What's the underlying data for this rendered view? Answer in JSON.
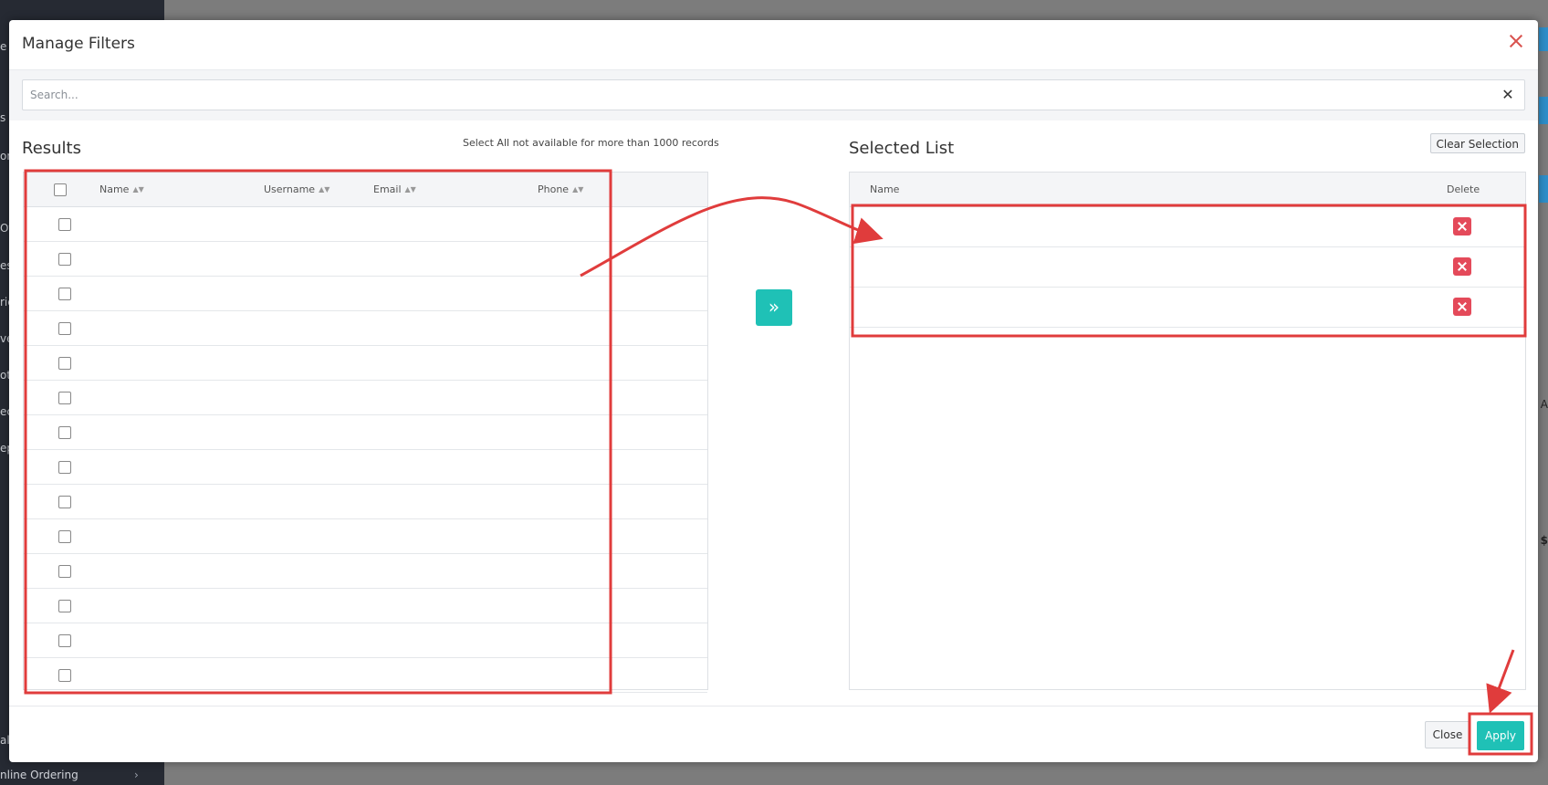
{
  "background": {
    "sidebar_bottom_item": "nline Ordering",
    "sidebar_fragments": [
      "e",
      "s",
      "on",
      "Of",
      "es",
      "ric",
      "ve",
      "ot",
      "ec",
      "ep",
      "al"
    ],
    "right_fragments": [
      "A",
      "$"
    ]
  },
  "modal": {
    "title": "Manage Filters",
    "search": {
      "placeholder": "Search...",
      "value": ""
    },
    "results": {
      "title": "Results",
      "note": "Select All not available for more than 1000 records",
      "columns": [
        "Name",
        "Username",
        "Email",
        "Phone"
      ],
      "row_count": 14
    },
    "move_button_glyph": "»",
    "selected": {
      "title": "Selected List",
      "clear_label": "Clear Selection",
      "columns": {
        "name": "Name",
        "delete": "Delete"
      },
      "rows": 3
    },
    "footer": {
      "close_label": "Close",
      "apply_label": "Apply"
    }
  },
  "colors": {
    "accent": "#1fc1b6",
    "danger": "#e44a5a",
    "annotation": "#e03c3c"
  }
}
